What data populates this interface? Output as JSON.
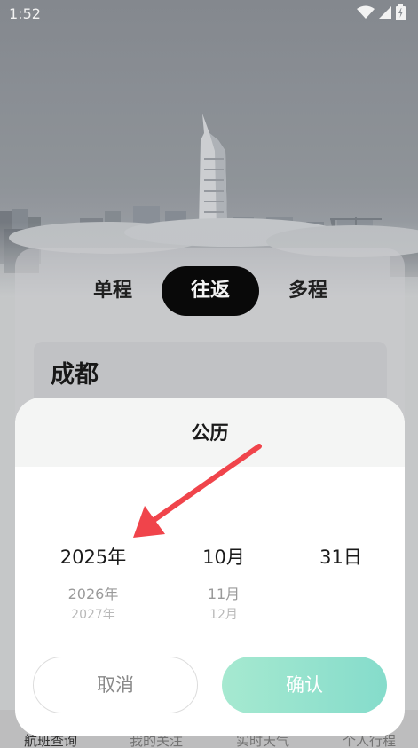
{
  "status_bar": {
    "time": "1:52",
    "icons": [
      "wifi-icon",
      "signal-icon",
      "battery-icon"
    ]
  },
  "trip_tabs": [
    {
      "label": "单程",
      "selected": false
    },
    {
      "label": "往返",
      "selected": true
    },
    {
      "label": "多程",
      "selected": false
    }
  ],
  "departure_city": "成都",
  "bottom_nav": [
    {
      "label": "航班查询",
      "active": true
    },
    {
      "label": "我的关注",
      "active": false
    },
    {
      "label": "实时天气",
      "active": false
    },
    {
      "label": "个人行程",
      "active": false
    }
  ],
  "date_picker": {
    "title": "公历",
    "year": {
      "selected": "2025年",
      "next": "2026年",
      "after": "2027年"
    },
    "month": {
      "selected": "10月",
      "next": "11月",
      "after": "12月"
    },
    "day": {
      "selected": "31日"
    },
    "cancel_label": "取消",
    "confirm_label": "确认"
  },
  "colors": {
    "confirm_gradient": [
      "#a6e9d0",
      "#85dccb"
    ],
    "annotation_arrow": "#f0444b",
    "selected_tab_bg": "#0a0a0a"
  }
}
